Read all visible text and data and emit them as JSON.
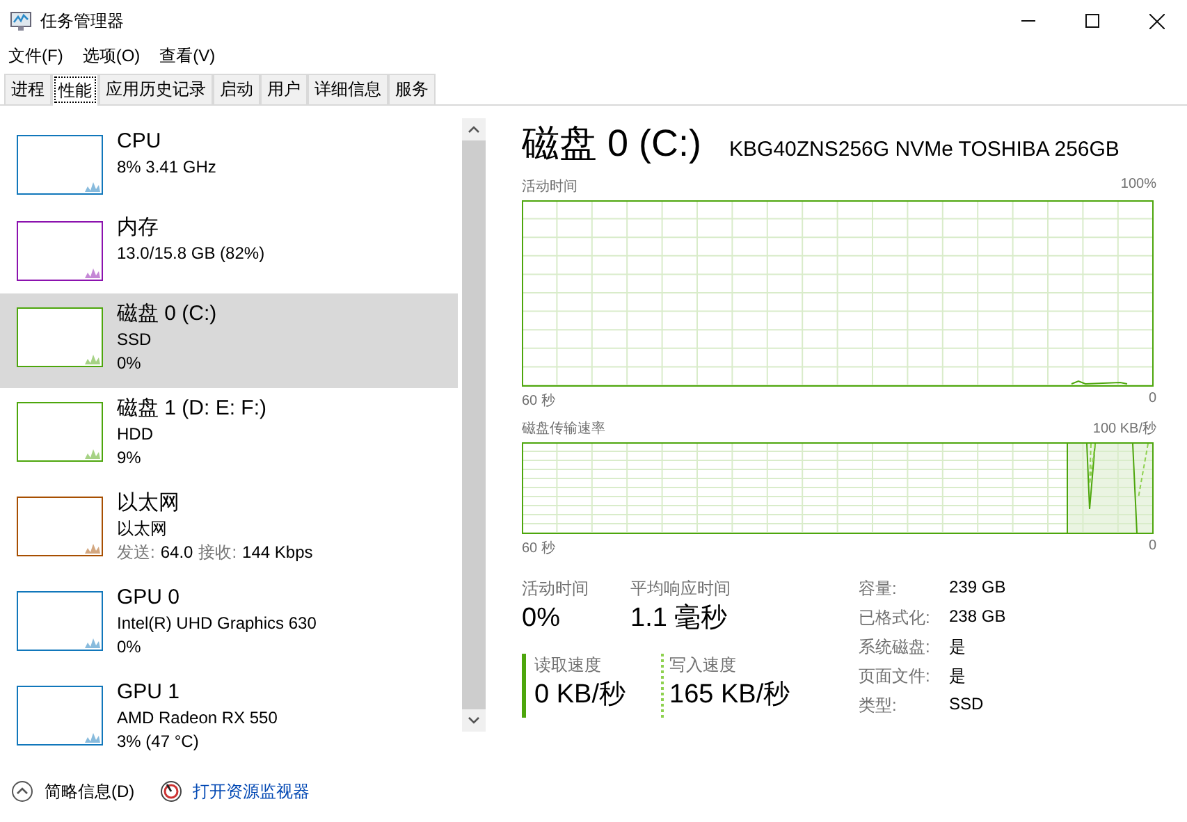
{
  "window": {
    "title": "任务管理器"
  },
  "menu": [
    "文件(F)",
    "选项(O)",
    "查看(V)"
  ],
  "tabs": [
    {
      "label": "进程",
      "selected": false
    },
    {
      "label": "性能",
      "selected": true
    },
    {
      "label": "应用历史记录",
      "selected": false
    },
    {
      "label": "启动",
      "selected": false
    },
    {
      "label": "用户",
      "selected": false
    },
    {
      "label": "详细信息",
      "selected": false
    },
    {
      "label": "服务",
      "selected": false
    }
  ],
  "sidebar": {
    "items": [
      {
        "name": "CPU",
        "lines": [
          "8% 3.41 GHz"
        ],
        "color": "#1177bb",
        "selected": false
      },
      {
        "name": "内存",
        "lines": [
          "13.0/15.8 GB (82%)"
        ],
        "color": "#8b12ae",
        "selected": false
      },
      {
        "name": "磁盘 0 (C:)",
        "lines": [
          "SSD",
          "0%"
        ],
        "color": "#4da60c",
        "selected": true
      },
      {
        "name": "磁盘 1 (D: E: F:)",
        "lines": [
          "HDD",
          "9%"
        ],
        "color": "#4da60c",
        "selected": false
      },
      {
        "name": "以太网",
        "lines": [
          "以太网"
        ],
        "rates": [
          {
            "label": "发送:",
            "value": "64.0"
          },
          {
            "label": "接收:",
            "value": "144 Kbps"
          }
        ],
        "color": "#a74f01",
        "selected": false
      },
      {
        "name": "GPU 0",
        "lines": [
          "Intel(R) UHD Graphics 630",
          "0%"
        ],
        "color": "#1177bb",
        "selected": false
      },
      {
        "name": "GPU 1",
        "lines": [
          "AMD Radeon RX 550",
          "3% (47 °C)"
        ],
        "color": "#1177bb",
        "selected": false
      }
    ]
  },
  "detail": {
    "title": "磁盘 0 (C:)",
    "model": "KBG40ZNS256G NVMe TOSHIBA 256GB",
    "graphs": [
      {
        "label": "活动时间",
        "max": "100%",
        "time": "60 秒",
        "min": "0"
      },
      {
        "label": "磁盘传输速率",
        "max": "100 KB/秒",
        "time": "60 秒",
        "min": "0"
      }
    ],
    "stats": [
      {
        "label": "活动时间",
        "value": "0%",
        "kind": "plain"
      },
      {
        "label": "平均响应时间",
        "value": "1.1 毫秒",
        "kind": "plain"
      },
      {
        "label": "读取速度",
        "value": "0 KB/秒",
        "kind": "solid"
      },
      {
        "label": "写入速度",
        "value": "165 KB/秒",
        "kind": "dotted"
      }
    ],
    "properties": [
      {
        "label": "容量:",
        "value": "239 GB"
      },
      {
        "label": "已格式化:",
        "value": "238 GB"
      },
      {
        "label": "系统磁盘:",
        "value": "是"
      },
      {
        "label": "页面文件:",
        "value": "是"
      },
      {
        "label": "类型:",
        "value": "SSD"
      }
    ]
  },
  "footer": {
    "summary": "简略信息(D)",
    "monitor": "打开资源监视器"
  }
}
